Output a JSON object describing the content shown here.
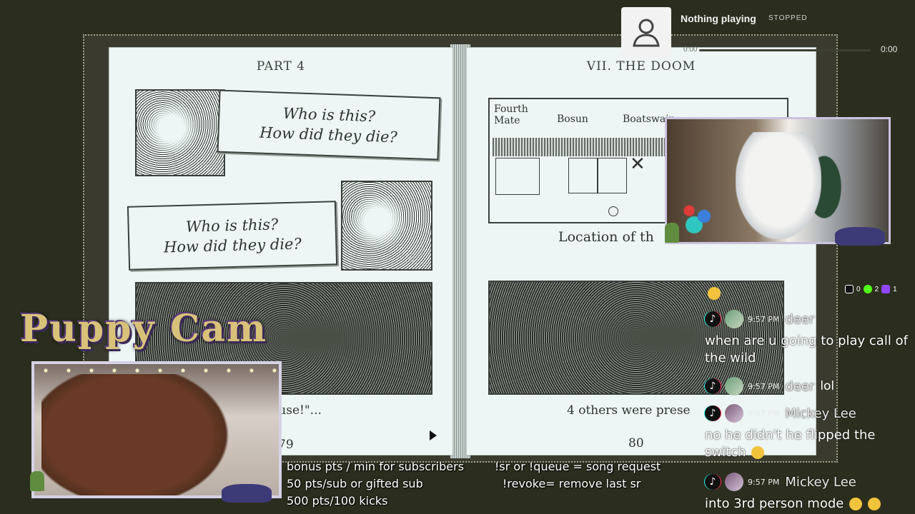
{
  "book": {
    "left_page": {
      "header": "PART 4",
      "notes": [
        "Who is this?\nHow did they die?",
        "Who is this?\nHow did they die?"
      ],
      "caption": "fuse!\"...",
      "page_number": "79"
    },
    "right_page": {
      "header": "VII. THE DOOM",
      "map_labels": [
        "Fourth Mate",
        "Bosun",
        "Boatswain"
      ],
      "map_caption": "Location of th",
      "caption": "4 others were prese",
      "page_number": "80"
    }
  },
  "music": {
    "title": "Nothing playing",
    "status": "STOPPED",
    "time_current": "0:00",
    "time_total": "0:00",
    "progress": 0
  },
  "platform_counts": [
    {
      "icon": "tiktok-icon",
      "count": "0"
    },
    {
      "icon": "kick-icon",
      "count": "2"
    },
    {
      "icon": "twitch-icon",
      "count": "1"
    }
  ],
  "chat": {
    "messages": [
      {
        "time": "9:57 PM",
        "user": "deer",
        "text": "when are u going to play call of the wild",
        "inline": ""
      },
      {
        "time": "9:57 PM",
        "user": "deer",
        "text": "",
        "inline": "lol"
      },
      {
        "time": "9:57 PM",
        "user": "Mickey Lee",
        "text": "no he didn't he flipped the switch",
        "inline": ""
      },
      {
        "time": "9:57 PM",
        "user": "Mickey Lee",
        "text": "into 3rd person mode",
        "inline": ""
      }
    ]
  },
  "puppy_cam": {
    "title": "Puppy Cam"
  },
  "info": {
    "left": [
      "bonus pts / min for subscribers",
      "50 pts/sub or gifted sub",
      "500 pts/100 kicks"
    ],
    "right": [
      "!sr or !queue = song request",
      "!revoke= remove last sr"
    ]
  },
  "colors": {
    "background": "#2b2e1e",
    "page": "#edf6f4",
    "ink": "#2e3330",
    "cam_border": "#c9c3dd"
  }
}
